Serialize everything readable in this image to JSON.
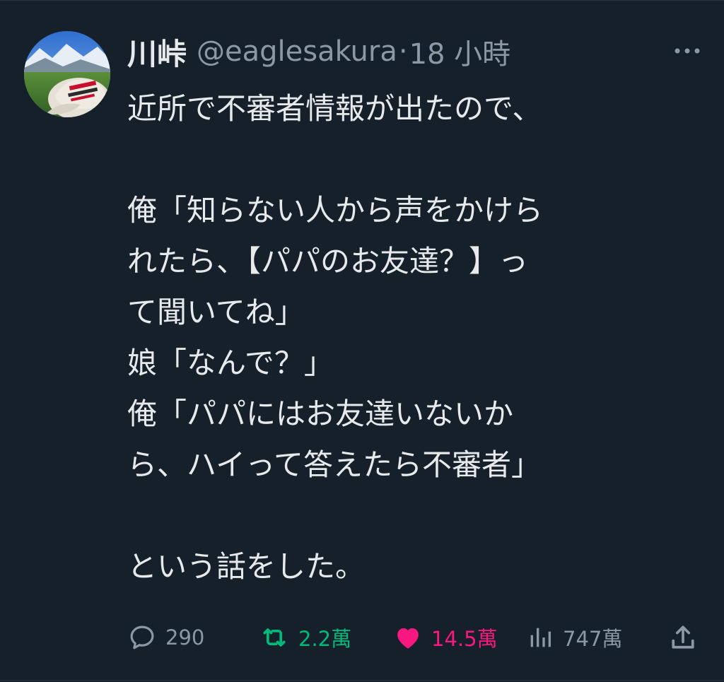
{
  "tweet": {
    "author": {
      "display_name": "川峠",
      "handle": "@eaglesakura"
    },
    "separator": "·",
    "timestamp": "18 小時",
    "text_lines": [
      "近所で不審者情報が出たので、",
      "",
      "俺「知らない人から声をかけら",
      "れたら、【パパのお友達？】っ",
      "て聞いてね」",
      "娘「なんで？」",
      "俺「パパにはお友達いないか",
      "ら、ハイって答えたら不審者」",
      "",
      "という話をした。"
    ],
    "stats": {
      "replies": "290",
      "retweets": "2.2萬",
      "likes": "14.5萬",
      "views": "747萬"
    }
  },
  "icons": {
    "more": "more-horizontal-icon",
    "reply": "reply-icon",
    "retweet": "retweet-icon",
    "like": "heart-filled-icon",
    "views": "views-bar-chart-icon",
    "share": "share-upload-icon"
  },
  "colors": {
    "background": "#15202b",
    "text_primary": "#e7e9ea",
    "text_secondary": "#8b98a5",
    "retweet": "#00ba7c",
    "like": "#f91880"
  }
}
